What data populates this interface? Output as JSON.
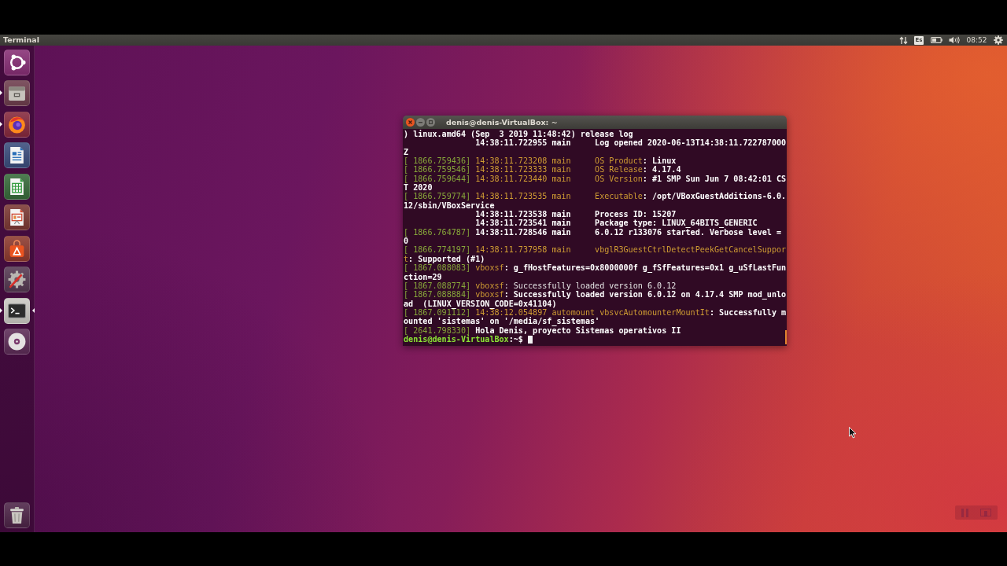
{
  "top_panel": {
    "app_title": "Terminal",
    "keyboard_layout": "Es",
    "clock": "08:52"
  },
  "launcher": {
    "items": [
      {
        "kind": "dash",
        "running": false,
        "focused": false
      },
      {
        "kind": "files",
        "running": true,
        "focused": false
      },
      {
        "kind": "browser",
        "running": true,
        "focused": false
      },
      {
        "kind": "writer",
        "running": false,
        "focused": false
      },
      {
        "kind": "spreadsheet",
        "running": false,
        "focused": false
      },
      {
        "kind": "presentation",
        "running": false,
        "focused": false
      },
      {
        "kind": "software",
        "running": false,
        "focused": false
      },
      {
        "kind": "settings",
        "running": false,
        "focused": false
      },
      {
        "kind": "terminal",
        "running": true,
        "focused": true
      },
      {
        "kind": "disc",
        "running": false,
        "focused": false
      }
    ],
    "bottom_items": [
      {
        "kind": "trash",
        "running": false,
        "focused": false
      }
    ]
  },
  "terminal": {
    "title": "denis@denis-VirtualBox: ~",
    "cursor_visible": true,
    "lines": [
      {
        "segments": [
          {
            "kind": "bold",
            "text": ") linux.amd64 (Sep  3 2019 11:48:42) release log"
          }
        ]
      },
      {
        "segments": [
          {
            "kind": "bold",
            "text": "               14:38:11.722955 main     Log opened 2020-06-13T14:38:11.722787000"
          }
        ]
      },
      {
        "segments": [
          {
            "kind": "bold",
            "text": "Z"
          }
        ]
      },
      {
        "segments": [
          {
            "kind": "dim",
            "text": "[ 1866.759436]"
          },
          {
            "kind": "accent",
            "text": " 14:38:11.723208 main     OS Product"
          },
          {
            "kind": "bold",
            "text": ": Linux"
          }
        ]
      },
      {
        "segments": [
          {
            "kind": "dim",
            "text": "[ 1866.759546]"
          },
          {
            "kind": "accent",
            "text": " 14:38:11.723333 main     OS Release"
          },
          {
            "kind": "bold",
            "text": ": 4.17.4"
          }
        ]
      },
      {
        "segments": [
          {
            "kind": "dim",
            "text": "[ 1866.759644]"
          },
          {
            "kind": "accent",
            "text": " 14:38:11.723440 main     OS Version"
          },
          {
            "kind": "bold",
            "text": ": #1 SMP Sun Jun 7 08:42:01 CS"
          }
        ]
      },
      {
        "segments": [
          {
            "kind": "bold",
            "text": "T 2020"
          }
        ]
      },
      {
        "segments": [
          {
            "kind": "dim",
            "text": "[ 1866.759774]"
          },
          {
            "kind": "accent",
            "text": " 14:38:11.723535 main     Executable"
          },
          {
            "kind": "bold",
            "text": ": /opt/VBoxGuestAdditions-6.0."
          }
        ]
      },
      {
        "segments": [
          {
            "kind": "bold",
            "text": "12/sbin/VBoxService"
          }
        ]
      },
      {
        "segments": [
          {
            "kind": "bold",
            "text": "               14:38:11.723538 main     Process ID: 15207"
          }
        ]
      },
      {
        "segments": [
          {
            "kind": "bold",
            "text": "               14:38:11.723541 main     Package type: LINUX_64BITS_GENERIC"
          }
        ]
      },
      {
        "segments": [
          {
            "kind": "dim",
            "text": "[ 1866.764787]"
          },
          {
            "kind": "bold",
            "text": " 14:38:11.728546 main     6.0.12 r133076 started. Verbose level ="
          }
        ]
      },
      {
        "segments": [
          {
            "kind": "bold",
            "text": "0"
          }
        ]
      },
      {
        "segments": [
          {
            "kind": "dim",
            "text": "[ 1866.774197]"
          },
          {
            "kind": "accent",
            "text": " 14:38:11.737958 main     vbglR3GuestCtrlDetectPeekGetCancelSuppor"
          }
        ]
      },
      {
        "segments": [
          {
            "kind": "accent",
            "text": "t"
          },
          {
            "kind": "bold",
            "text": ": Supported (#1)"
          }
        ]
      },
      {
        "segments": [
          {
            "kind": "dim",
            "text": "[ 1867.088083]"
          },
          {
            "kind": "accent",
            "text": " vboxsf"
          },
          {
            "kind": "bold",
            "text": ": g_fHostFeatures=0x8000000f g_fSfFeatures=0x1 g_uSfLastFun"
          }
        ]
      },
      {
        "segments": [
          {
            "kind": "bold",
            "text": "ction=29"
          }
        ]
      },
      {
        "segments": [
          {
            "kind": "dim",
            "text": "[ 1867.088774]"
          },
          {
            "kind": "accent",
            "text": " vboxsf"
          },
          {
            "kind": "plain",
            "text": ": Successfully loaded version 6.0.12"
          }
        ]
      },
      {
        "segments": [
          {
            "kind": "dim",
            "text": "[ 1867.088884]"
          },
          {
            "kind": "accent",
            "text": " vboxsf"
          },
          {
            "kind": "bold",
            "text": ": Successfully loaded version 6.0.12 on 4.17.4 SMP mod_unlo"
          }
        ]
      },
      {
        "segments": [
          {
            "kind": "bold",
            "text": "ad  (LINUX_VERSION_CODE=0x41104)"
          }
        ]
      },
      {
        "segments": [
          {
            "kind": "dim",
            "text": "[ 1867.091112]"
          },
          {
            "kind": "accent",
            "text": " 14:38:12.054897 automount vbsvcAutomounterMountIt"
          },
          {
            "kind": "bold",
            "text": ": Successfully m"
          }
        ]
      },
      {
        "segments": [
          {
            "kind": "bold",
            "text": "ounted 'sistemas' on '/media/sf_sistemas'"
          }
        ]
      },
      {
        "segments": [
          {
            "kind": "dim",
            "text": "[ 2641.798330]"
          },
          {
            "kind": "bold",
            "text": " Hola Denis, proyecto Sistemas operativos II"
          }
        ]
      },
      {
        "segments": [
          {
            "kind": "prompt",
            "text": "denis@denis-VirtualBox"
          },
          {
            "kind": "bold",
            "text": ":~$"
          }
        ]
      }
    ]
  }
}
